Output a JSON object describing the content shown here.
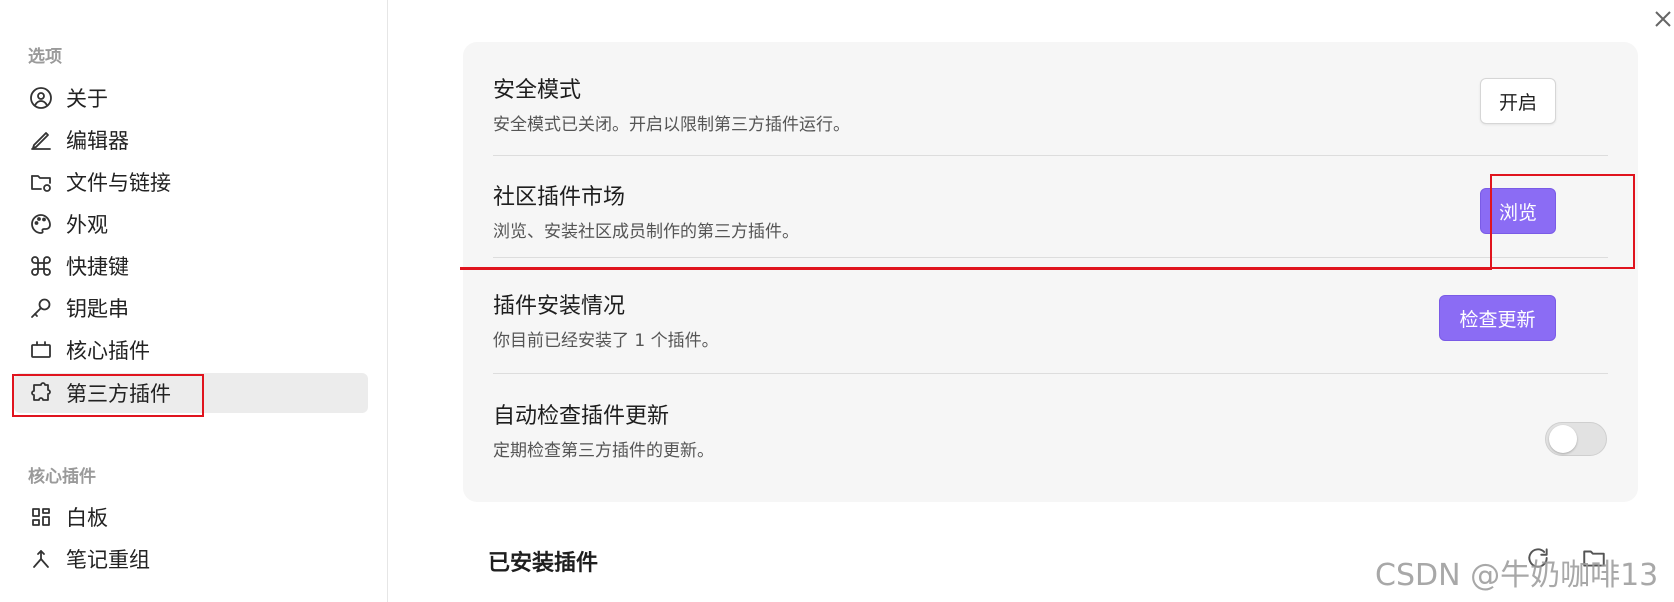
{
  "sidebar": {
    "options_heading": "选项",
    "options_items": [
      {
        "label": "关于",
        "icon": "user-circle-icon"
      },
      {
        "label": "编辑器",
        "icon": "pencil-icon"
      },
      {
        "label": "文件与链接",
        "icon": "folder-settings-icon"
      },
      {
        "label": "外观",
        "icon": "palette-icon"
      },
      {
        "label": "快捷键",
        "icon": "command-icon"
      },
      {
        "label": "钥匙串",
        "icon": "key-icon"
      },
      {
        "label": "核心插件",
        "icon": "briefcase-icon"
      },
      {
        "label": "第三方插件",
        "icon": "puzzle-icon",
        "active": true
      }
    ],
    "core_heading": "核心插件",
    "core_items": [
      {
        "label": "白板",
        "icon": "grid-icon"
      },
      {
        "label": "笔记重组",
        "icon": "merge-icon"
      }
    ]
  },
  "settings": {
    "safe_mode": {
      "title": "安全模式",
      "desc": "安全模式已关闭。开启以限制第三方插件运行。",
      "button": "开启"
    },
    "community": {
      "title": "社区插件市场",
      "desc": "浏览、安装社区成员制作的第三方插件。",
      "button": "浏览"
    },
    "install_status": {
      "title": "插件安装情况",
      "desc": "你目前已经安装了 1 个插件。",
      "button": "检查更新"
    },
    "auto_check": {
      "title": "自动检查插件更新",
      "desc": "定期检查第三方插件的更新。",
      "toggle_on": false
    }
  },
  "installed": {
    "heading": "已安装插件"
  },
  "watermark": "CSDN @牛奶咖啡13",
  "colors": {
    "accent": "#8b6cf4",
    "annotation": "#e0141e"
  }
}
